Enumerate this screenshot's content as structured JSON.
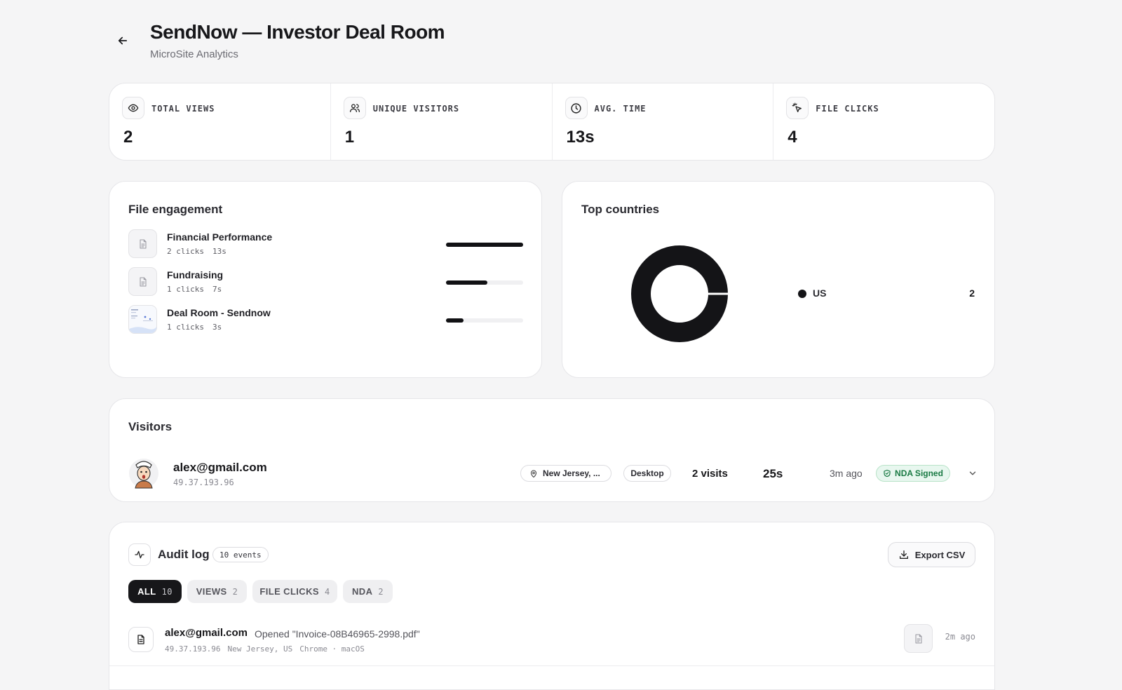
{
  "header": {
    "title": "SendNow — Investor Deal Room",
    "subtitle": "MicroSite Analytics",
    "back_icon": "arrow-left-icon"
  },
  "stats": [
    {
      "icon": "eye-icon",
      "label": "TOTAL VIEWS",
      "value": "2"
    },
    {
      "icon": "users-icon",
      "label": "UNIQUE VISITORS",
      "value": "1"
    },
    {
      "icon": "clock-icon",
      "label": "AVG. TIME",
      "value": "13s"
    },
    {
      "icon": "cursor-click-icon",
      "label": "FILE CLICKS",
      "value": "4"
    }
  ],
  "file_engagement": {
    "title": "File engagement",
    "files": [
      {
        "name": "Financial Performance",
        "clicks": "2 clicks",
        "time": "13s",
        "share": 1.0
      },
      {
        "name": "Fundraising",
        "clicks": "1 clicks",
        "time": "7s",
        "share": 0.54
      },
      {
        "name": "Deal Room - Sendnow",
        "clicks": "1 clicks",
        "time": "3s",
        "share": 0.23
      }
    ]
  },
  "countries": {
    "title": "Top countries",
    "items": [
      {
        "label": "US",
        "value": "2"
      }
    ],
    "color": "#141417"
  },
  "visitors": {
    "title": "Visitors",
    "rows": [
      {
        "email": "alex@gmail.com",
        "ip": "49.37.193.96",
        "location": "New Jersey, ...",
        "device": "Desktop",
        "visits": "2 visits",
        "time": "25s",
        "ago": "3m ago",
        "badge": "NDA Signed"
      }
    ]
  },
  "audit": {
    "title": "Audit log",
    "count": "10 events",
    "export_label": "Export CSV",
    "tabs": [
      {
        "label": "ALL",
        "count": "10"
      },
      {
        "label": "VIEWS",
        "count": "2"
      },
      {
        "label": "FILE CLICKS",
        "count": "4"
      },
      {
        "label": "NDA",
        "count": "2"
      }
    ],
    "events": [
      {
        "user": "alex@gmail.com",
        "action": "Opened \"Invoice-08B46965-2998.pdf\"",
        "ip": "49.37.193.96",
        "location": "New Jersey, US",
        "client": "Chrome · macOS",
        "ago": "2m ago"
      }
    ]
  },
  "colors": {
    "accent": "#17171a",
    "success": "#1a7a44",
    "success_bg": "#e8f7ef"
  }
}
